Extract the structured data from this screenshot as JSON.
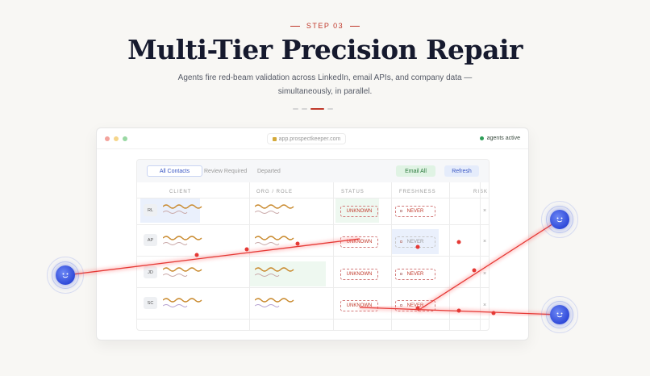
{
  "step": "STEP 03",
  "title": "Multi-Tier Precision Repair",
  "subtitle": "Agents fire red-beam validation across LinkedIn, email APIs, and company data — simultaneously, in parallel.",
  "window": {
    "url": "app.prospectkeeper.com",
    "status": "agents active"
  },
  "toolbar": {
    "tabs": [
      "All Contacts",
      "Review Required",
      "Departed"
    ],
    "email_all": "Email All",
    "refresh": "Refresh"
  },
  "table": {
    "columns": [
      "CLIENT",
      "ORG / ROLE",
      "STATUS",
      "FRESHNESS",
      "RISK"
    ],
    "rows": [
      {
        "initials": "RL",
        "status": "UNKNOWN",
        "freshness": "NEVER",
        "risk": "×"
      },
      {
        "initials": "AP",
        "status": "UNKNOWN",
        "freshness": "NEVER",
        "risk": "×"
      },
      {
        "initials": "JD",
        "status": "UNKNOWN",
        "freshness": "NEVER",
        "risk": "×"
      },
      {
        "initials": "SC",
        "status": "UNKNOWN",
        "freshness": "NEVER",
        "risk": "×"
      }
    ]
  },
  "colors": {
    "accent": "#c0392b",
    "agent": "#3a57e4",
    "beam": "#e53935",
    "active": "#2e9e58"
  },
  "icons": [
    "lock-icon",
    "status-dot-icon",
    "agent-face-icon"
  ]
}
